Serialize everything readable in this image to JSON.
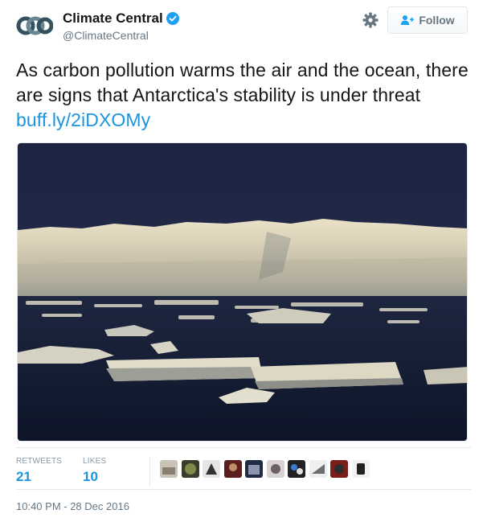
{
  "account": {
    "display_name": "Climate Central",
    "handle": "@ClimateCentral",
    "verified": true
  },
  "actions": {
    "follow_label": "Follow",
    "icons": [
      "gear-icon",
      "add-user-icon"
    ]
  },
  "tweet": {
    "text": "As carbon pollution warms the air and the ocean, there are signs that Antarctica's stability is under threat ",
    "link_text": "buff.ly/2iDXOMy"
  },
  "stats": {
    "retweets_label": "RETWEETS",
    "retweets_value": "21",
    "likes_label": "LIKES",
    "likes_value": "10"
  },
  "timestamp": "10:40 PM - 28 Dec 2016",
  "colors": {
    "link": "#1b95e0",
    "text": "#14171a",
    "secondary": "#657786",
    "border": "#e1e8ed",
    "verified": "#1da1f2"
  }
}
